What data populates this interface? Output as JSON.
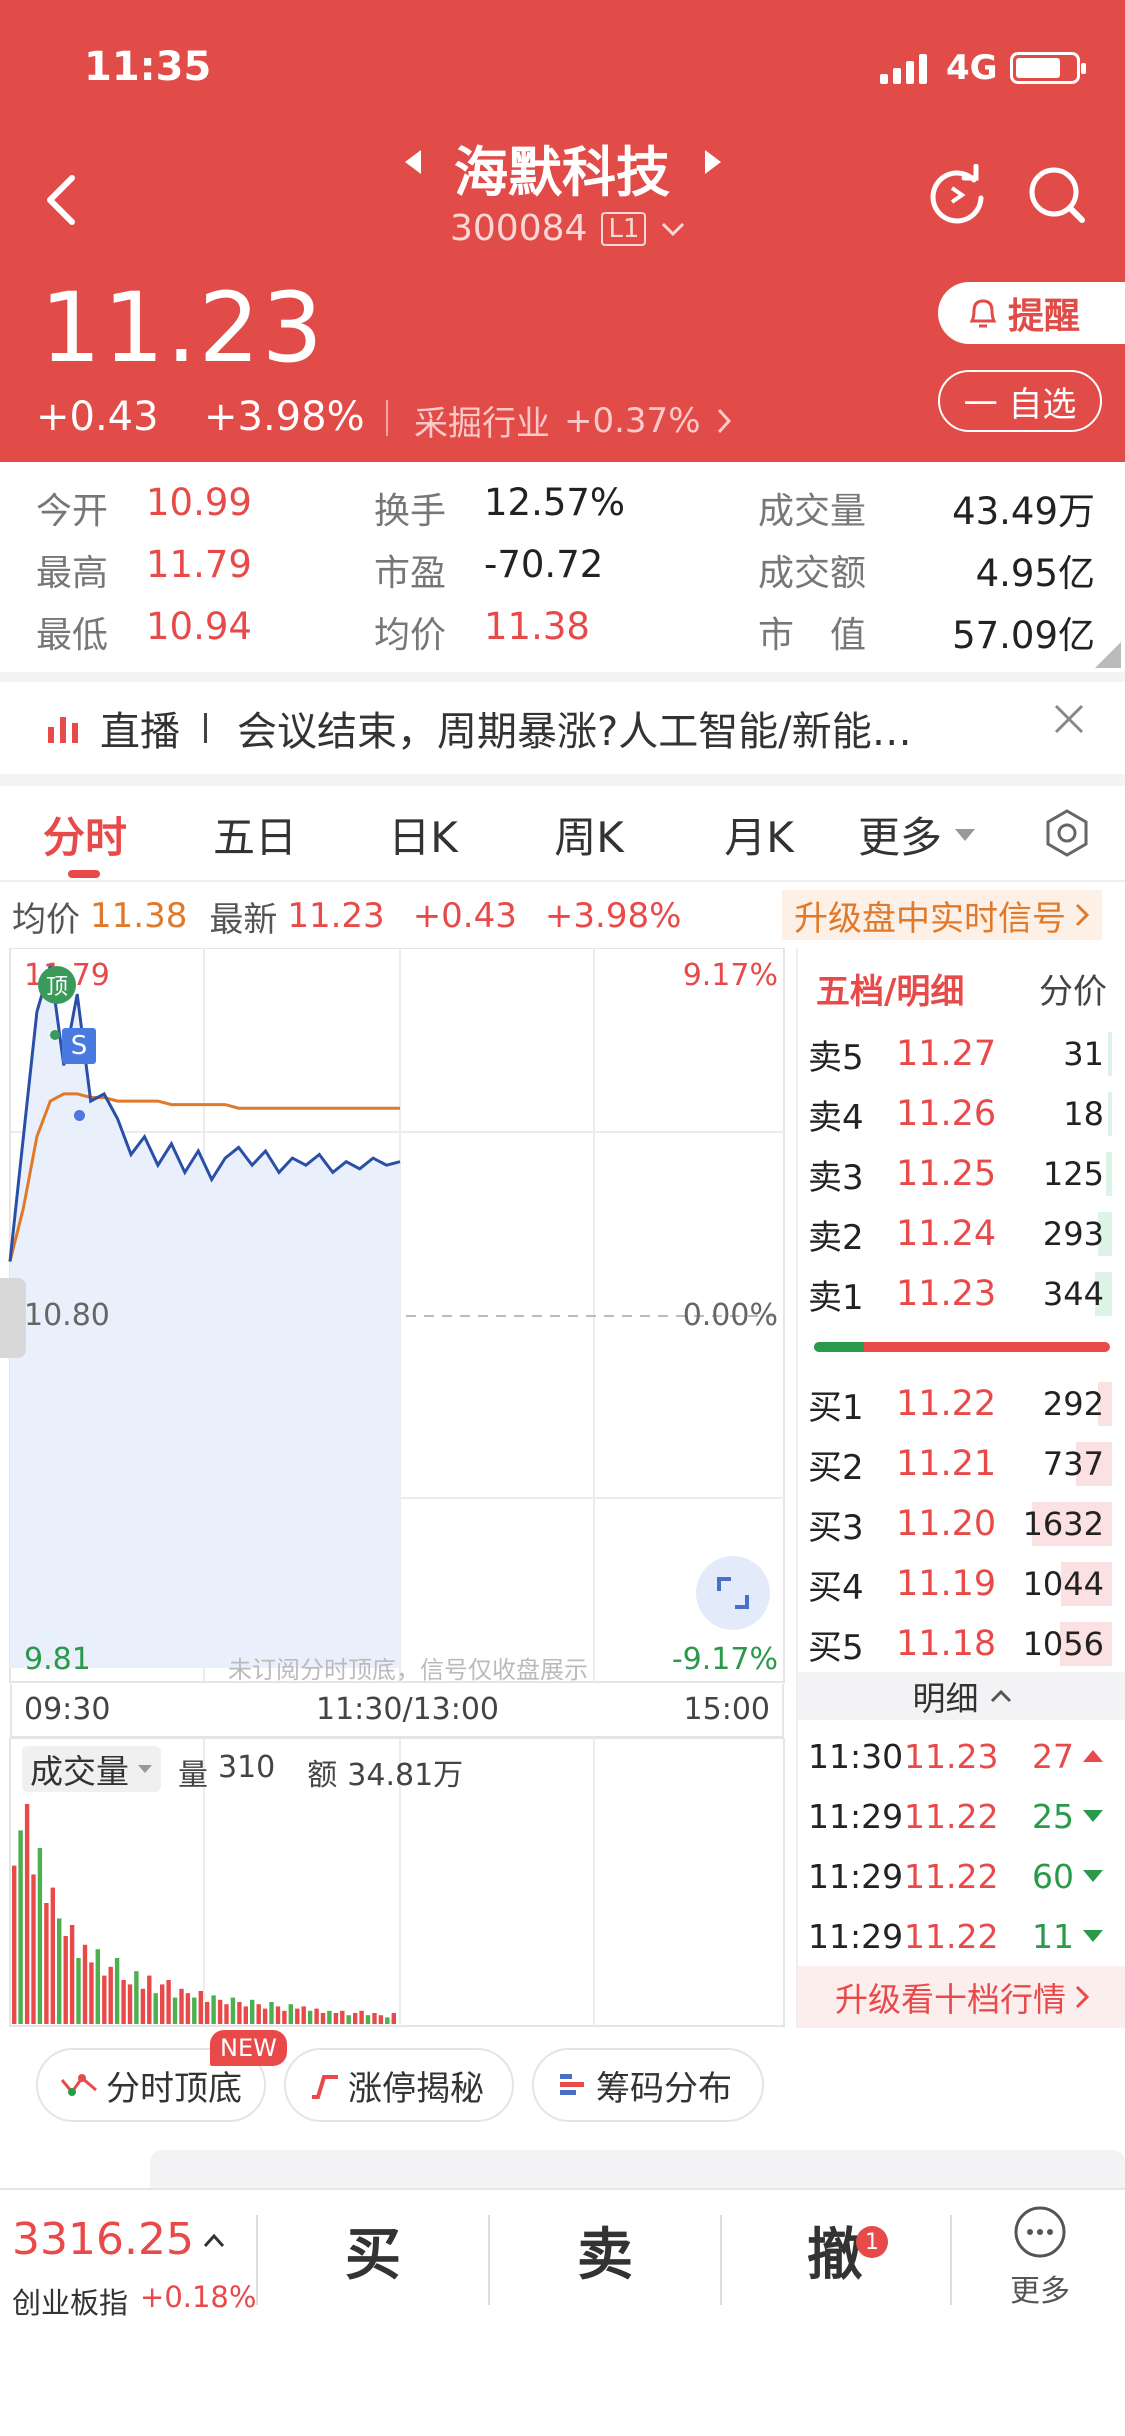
{
  "status_bar": {
    "time": "11:35",
    "network": "4G"
  },
  "header": {
    "stock_name": "海默科技",
    "stock_code": "300084",
    "level_badge": "L1",
    "price": "11.23",
    "change": "+0.43",
    "change_pct": "+3.98%",
    "industry": "采掘行业",
    "industry_change": "+0.37%",
    "remind_label": "提醒",
    "watchlist_label": "一 自选"
  },
  "stats": [
    [
      {
        "label": "今开",
        "value": "10.99",
        "color": "red"
      },
      {
        "label": "换手",
        "value": "12.57%",
        "color": "dark"
      },
      {
        "label": "成交量",
        "value": "43.49万",
        "color": "dark"
      }
    ],
    [
      {
        "label": "最高",
        "value": "11.79",
        "color": "red"
      },
      {
        "label": "市盈",
        "value": "-70.72",
        "color": "dark"
      },
      {
        "label": "成交额",
        "value": "4.95亿",
        "color": "dark"
      }
    ],
    [
      {
        "label": "最低",
        "value": "10.94",
        "color": "red"
      },
      {
        "label": "均价",
        "value": "11.38",
        "color": "red"
      },
      {
        "label": "市　值",
        "value": "57.09亿",
        "color": "dark"
      }
    ]
  ],
  "live_banner": {
    "tag": "直播",
    "text": "会议结束，周期暴涨?人工智能/新能…"
  },
  "tabs": [
    "分时",
    "五日",
    "日K",
    "周K",
    "月K",
    "更多"
  ],
  "active_tab": "分时",
  "chart_info": {
    "avg_label": "均价",
    "avg_value": "11.38",
    "latest_label": "最新",
    "latest_value": "11.23",
    "change": "+0.43",
    "change_pct": "+3.98%",
    "upgrade_signal": "升级盘中实时信号"
  },
  "price_chart": {
    "high_label": "11.79",
    "mid_label": "10.80",
    "low_label": "9.81",
    "pct_high": "9.17%",
    "pct_mid": "0.00%",
    "pct_low": "-9.17%",
    "time_start": "09:30",
    "time_mid": "11:30/13:00",
    "time_end": "15:00",
    "marker_top": "顶",
    "marker_s": "S",
    "watermark": "未订阅分时顶底，信号仅收盘展示"
  },
  "chart_data": {
    "type": "line",
    "x_range": [
      "09:30",
      "15:00"
    ],
    "ylim": [
      9.81,
      11.79
    ],
    "series": [
      {
        "values": [
          10.95,
          11.3,
          11.65,
          11.78,
          11.5,
          11.7,
          11.4,
          11.42,
          11.35,
          11.25,
          11.3,
          11.22,
          11.28,
          11.2,
          11.26,
          11.18,
          11.24,
          11.27,
          11.22,
          11.26,
          11.2,
          11.24,
          11.22,
          11.25,
          11.2,
          11.23,
          11.21,
          11.24,
          11.22,
          11.23
        ]
      },
      {
        "values": [
          10.95,
          11.1,
          11.3,
          11.4,
          11.42,
          11.42,
          11.41,
          11.41,
          11.4,
          11.4,
          11.4,
          11.4,
          11.39,
          11.39,
          11.39,
          11.39,
          11.39,
          11.38,
          11.38,
          11.38,
          11.38,
          11.38,
          11.38,
          11.38,
          11.38,
          11.38,
          11.38,
          11.38,
          11.38,
          11.38
        ]
      }
    ]
  },
  "volume": {
    "title": "成交量",
    "qty_label": "量",
    "qty_value": "310",
    "amt_label": "额",
    "amt_value": "34.81万"
  },
  "volume_data": [
    72,
    88,
    100,
    68,
    80,
    55,
    62,
    48,
    40,
    45,
    30,
    36,
    28,
    34,
    22,
    26,
    30,
    20,
    18,
    24,
    16,
    22,
    14,
    18,
    20,
    12,
    16,
    14,
    12,
    15,
    10,
    13,
    11,
    9,
    12,
    10,
    8,
    11,
    9,
    7,
    10,
    8,
    6,
    9,
    7,
    8,
    6,
    7,
    5,
    6,
    5,
    6,
    4,
    5,
    6,
    4,
    5,
    4,
    3,
    5
  ],
  "orderbook": {
    "title": "五档/明细",
    "alt": "分价",
    "sells": [
      {
        "label": "卖5",
        "price": "11.27",
        "vol": "31",
        "bar": 0.02
      },
      {
        "label": "卖4",
        "price": "11.26",
        "vol": "18",
        "bar": 0.01
      },
      {
        "label": "卖3",
        "price": "11.25",
        "vol": "125",
        "bar": 0.06
      },
      {
        "label": "卖2",
        "price": "11.24",
        "vol": "293",
        "bar": 0.14
      },
      {
        "label": "卖1",
        "price": "11.23",
        "vol": "344",
        "bar": 0.17
      }
    ],
    "buys": [
      {
        "label": "买1",
        "price": "11.22",
        "vol": "292",
        "bar": 0.14
      },
      {
        "label": "买2",
        "price": "11.21",
        "vol": "737",
        "bar": 0.36
      },
      {
        "label": "买3",
        "price": "11.20",
        "vol": "1632",
        "bar": 0.8
      },
      {
        "label": "买4",
        "price": "11.19",
        "vol": "1044",
        "bar": 0.51
      },
      {
        "label": "买5",
        "price": "11.18",
        "vol": "1056",
        "bar": 0.52
      }
    ],
    "detail_title": "明细",
    "details": [
      {
        "time": "11:30",
        "price": "11.23",
        "vol": "27",
        "dir": "up"
      },
      {
        "time": "11:29",
        "price": "11.22",
        "vol": "25",
        "dir": "down"
      },
      {
        "time": "11:29",
        "price": "11.22",
        "vol": "60",
        "dir": "down"
      },
      {
        "time": "11:29",
        "price": "11.22",
        "vol": "11",
        "dir": "down"
      }
    ],
    "upgrade": "升级看十档行情"
  },
  "chips": [
    {
      "label": "分时顶底",
      "badge": "NEW"
    },
    {
      "label": "涨停揭秘"
    },
    {
      "label": "筹码分布"
    }
  ],
  "bottom_bar": {
    "index_value": "3316.25",
    "index_name": "创业板指",
    "index_change": "+0.18%",
    "buy": "买",
    "sell": "卖",
    "cancel": "撤",
    "cancel_badge": "1",
    "more": "更多"
  },
  "colors": {
    "brand_red": "#e14b48",
    "up_red": "#e84a4a",
    "down_green": "#2a9a4a",
    "avg_orange": "#e07a2a",
    "price_blue": "#2a4fa8"
  }
}
